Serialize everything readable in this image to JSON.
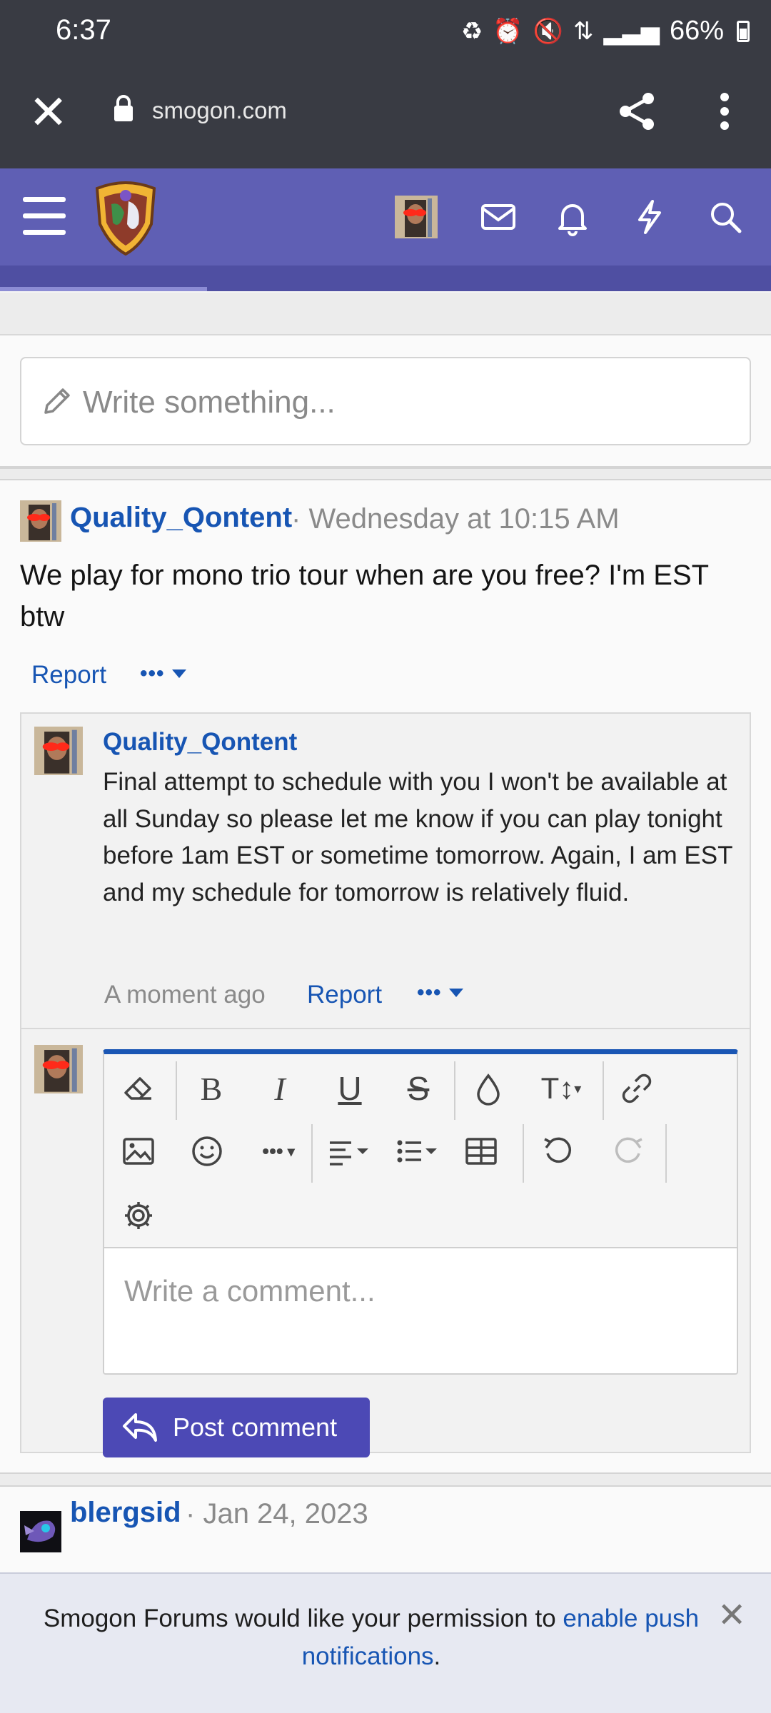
{
  "status": {
    "time": "6:37",
    "battery": "66%"
  },
  "browser": {
    "url": "smogon.com"
  },
  "write": {
    "placeholder": "Write something..."
  },
  "post": {
    "author": "Quality_Qontent",
    "separator": "·",
    "date": "Wednesday at 10:15 AM",
    "text": "We play for mono trio tour when are you free? I'm EST btw",
    "report": "Report",
    "more": "•••"
  },
  "comment": {
    "author": "Quality_Qontent",
    "text": "Final attempt to schedule with you I won't be available at all Sunday so please let me know if you can play tonight before 1am EST or sometime tomorrow. Again, I am EST and my schedule for tomorrow is relatively fluid.",
    "time": "A moment ago",
    "report": "Report",
    "more": "•••"
  },
  "editor": {
    "placeholder": "Write a comment...",
    "post_label": "Post comment",
    "tools": [
      "eraser-icon",
      "bold-icon",
      "italic-icon",
      "underline-icon",
      "strikethrough-icon",
      "color-icon",
      "font-size-icon",
      "link-icon",
      "image-icon",
      "smiley-icon",
      "more-icon",
      "align-icon",
      "list-icon",
      "table-icon",
      "undo-icon",
      "redo-icon",
      "settings-icon"
    ]
  },
  "post2": {
    "author": "blergsid",
    "separator": "·",
    "date": "Jan 24, 2023"
  },
  "notification": {
    "text_before": "Smogon Forums would like your permission to ",
    "link": "enable push notifications",
    "text_after": ".",
    "close": "✕"
  },
  "colors": {
    "header": "#5f5fb4",
    "link": "#1755b3",
    "button": "#4c49b5"
  }
}
